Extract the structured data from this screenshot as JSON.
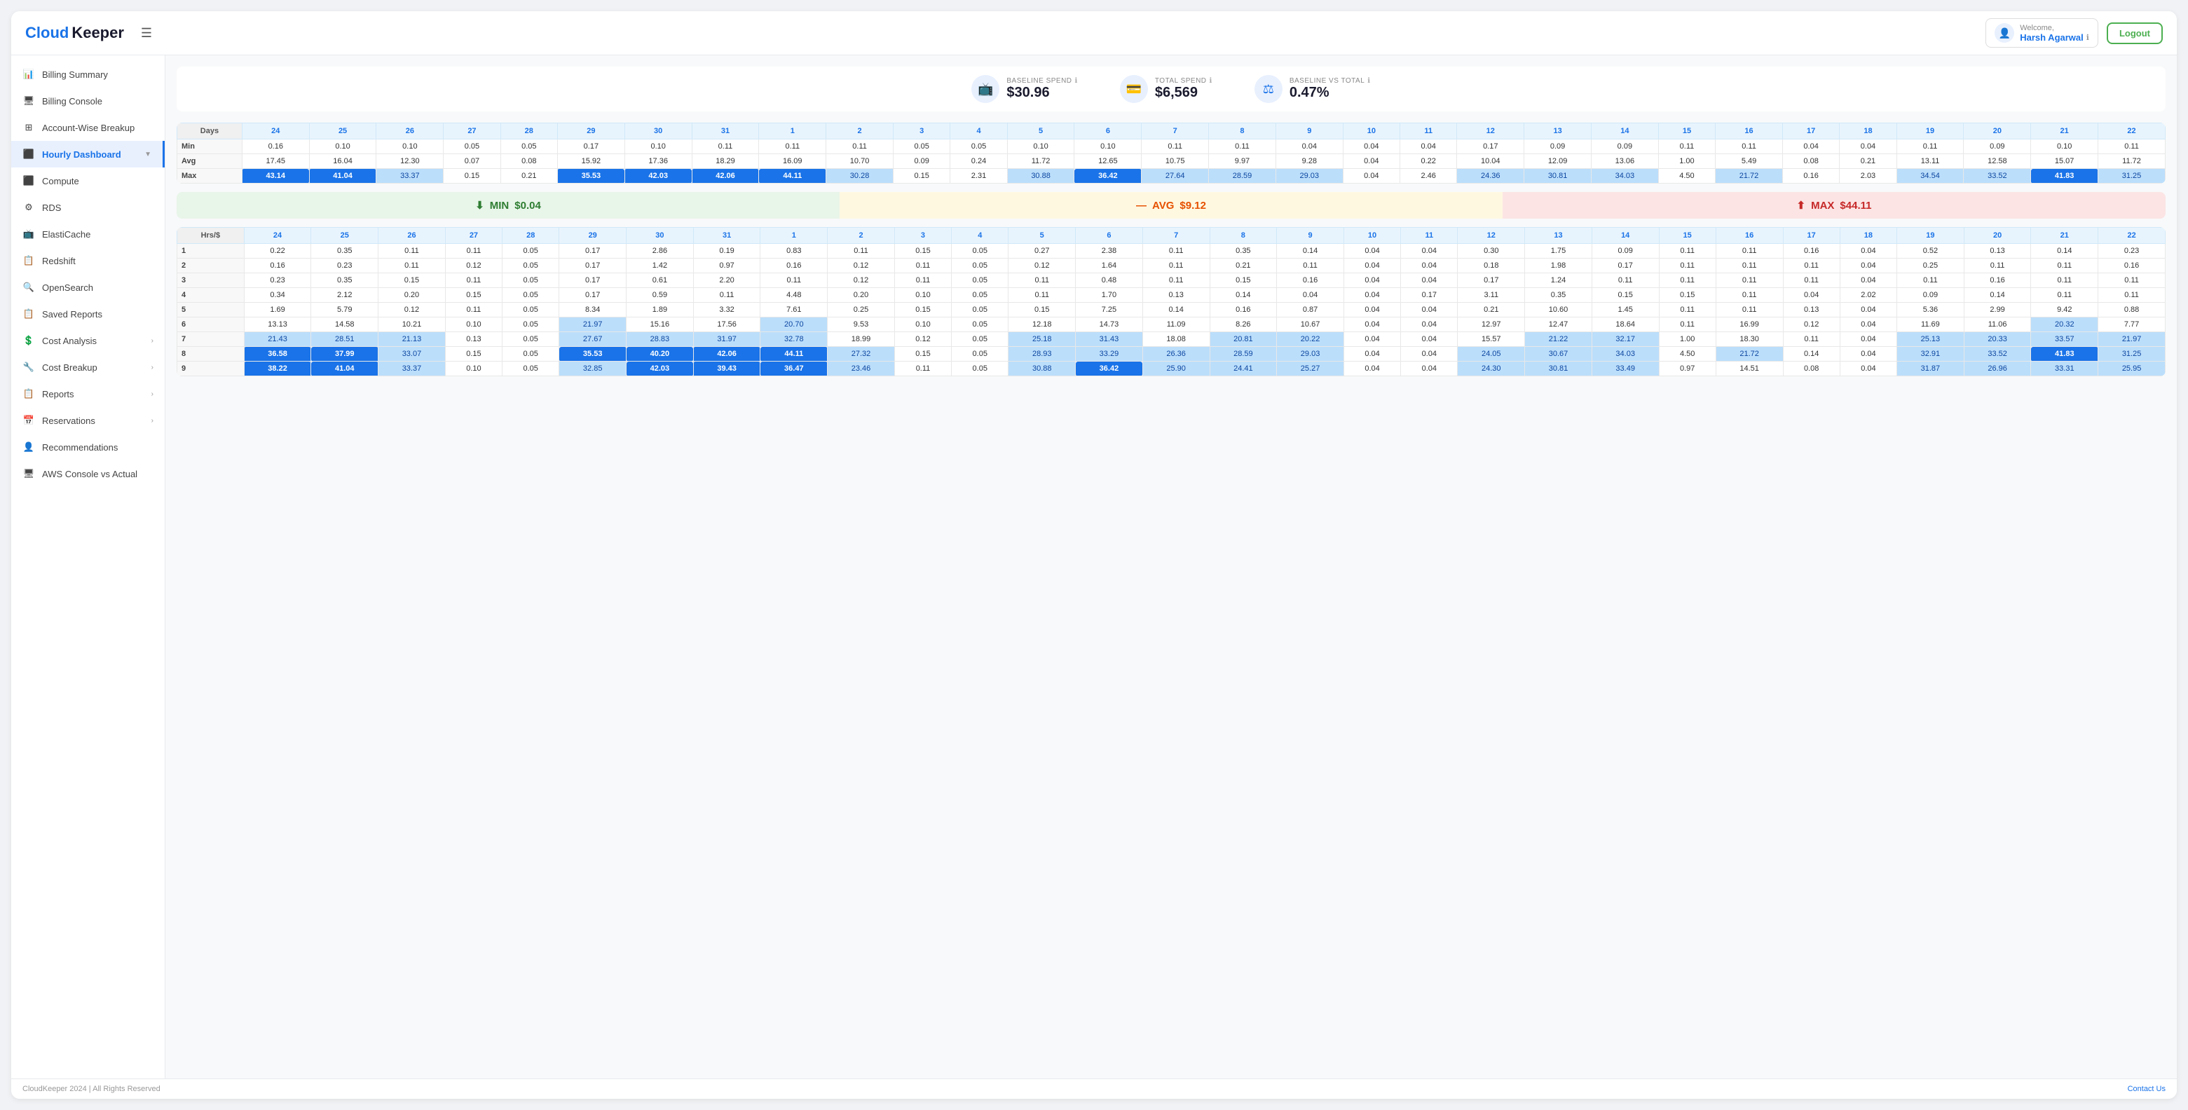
{
  "header": {
    "logo_cloud": "Cloud",
    "logo_keeper": "Keeper",
    "hamburger_label": "☰",
    "welcome_prefix": "Welcome,",
    "username": "Harsh Agarwal",
    "logout_label": "Logout"
  },
  "sidebar": {
    "items": [
      {
        "id": "billing-summary",
        "label": "Billing Summary",
        "icon": "📊",
        "active": false
      },
      {
        "id": "billing-console",
        "label": "Billing Console",
        "icon": "🖥",
        "active": false
      },
      {
        "id": "account-wise-breakup",
        "label": "Account-Wise Breakup",
        "icon": "⊞",
        "active": false
      },
      {
        "id": "hourly-dashboard",
        "label": "Hourly Dashboard",
        "icon": "⬛",
        "active": true,
        "hasArrow": true
      },
      {
        "id": "compute",
        "label": "Compute",
        "icon": "⬛",
        "active": false
      },
      {
        "id": "rds",
        "label": "RDS",
        "icon": "⚙",
        "active": false
      },
      {
        "id": "elasticache",
        "label": "ElastiCache",
        "icon": "📺",
        "active": false
      },
      {
        "id": "redshift",
        "label": "Redshift",
        "icon": "📋",
        "active": false
      },
      {
        "id": "opensearch",
        "label": "OpenSearch",
        "icon": "🔍",
        "active": false
      },
      {
        "id": "saved-reports",
        "label": "Saved Reports",
        "icon": "📋",
        "active": false
      },
      {
        "id": "cost-analysis",
        "label": "Cost Analysis",
        "icon": "💲",
        "active": false,
        "hasArrow": true
      },
      {
        "id": "cost-breakup",
        "label": "Cost Breakup",
        "icon": "🔧",
        "active": false,
        "hasArrow": true
      },
      {
        "id": "reports",
        "label": "Reports",
        "icon": "📋",
        "active": false,
        "hasArrow": true
      },
      {
        "id": "reservations",
        "label": "Reservations",
        "icon": "📅",
        "active": false,
        "hasArrow": true
      },
      {
        "id": "recommendations",
        "label": "Recommendations",
        "icon": "👤",
        "active": false
      },
      {
        "id": "aws-console-vs-actual",
        "label": "AWS Console vs Actual",
        "icon": "🖥",
        "active": false
      }
    ]
  },
  "stats": {
    "baseline_spend_label": "BASELINE SPEND",
    "baseline_spend_value": "$30.96",
    "total_spend_label": "TOTAL SPEND",
    "total_spend_value": "$6,569",
    "baseline_vs_total_label": "BASELINE vs TOTAL",
    "baseline_vs_total_value": "0.47%"
  },
  "summary": {
    "min_label": "MIN",
    "min_value": "$0.04",
    "avg_label": "AVG",
    "avg_value": "$9.12",
    "max_label": "MAX",
    "max_value": "$44.11"
  },
  "top_table": {
    "headers": [
      "Days",
      "24",
      "25",
      "26",
      "27",
      "28",
      "29",
      "30",
      "31",
      "1",
      "2",
      "3",
      "4",
      "5",
      "6",
      "7",
      "8",
      "9",
      "10",
      "11",
      "12",
      "13",
      "14",
      "15",
      "16",
      "17",
      "18",
      "19",
      "20",
      "21",
      "22"
    ],
    "rows": [
      {
        "label": "Min",
        "values": [
          "0.16",
          "0.10",
          "0.10",
          "0.05",
          "0.05",
          "0.17",
          "0.10",
          "0.11",
          "0.11",
          "0.11",
          "0.05",
          "0.05",
          "0.10",
          "0.10",
          "0.11",
          "0.11",
          "0.04",
          "0.04",
          "0.04",
          "0.17",
          "0.09",
          "0.09",
          "0.11",
          "0.11",
          "0.04",
          "0.04",
          "0.11",
          "0.09",
          "0.10",
          "0.11"
        ]
      },
      {
        "label": "Avg",
        "values": [
          "17.45",
          "16.04",
          "12.30",
          "0.07",
          "0.08",
          "15.92",
          "17.36",
          "18.29",
          "16.09",
          "10.70",
          "0.09",
          "0.24",
          "11.72",
          "12.65",
          "10.75",
          "9.97",
          "9.28",
          "0.04",
          "0.22",
          "10.04",
          "12.09",
          "13.06",
          "1.00",
          "5.49",
          "0.08",
          "0.21",
          "13.11",
          "12.58",
          "15.07",
          "11.72"
        ]
      },
      {
        "label": "Max",
        "values": [
          "43.14",
          "41.04",
          "33.37",
          "0.15",
          "0.21",
          "35.53",
          "42.03",
          "42.06",
          "44.11",
          "30.28",
          "0.15",
          "2.31",
          "30.88",
          "36.42",
          "27.64",
          "28.59",
          "29.03",
          "0.04",
          "2.46",
          "24.36",
          "30.81",
          "34.03",
          "4.50",
          "21.72",
          "0.16",
          "2.03",
          "34.54",
          "33.52",
          "41.83",
          "31.25"
        ]
      }
    ]
  },
  "main_table": {
    "headers": [
      "Hrs/$",
      "24",
      "25",
      "26",
      "27",
      "28",
      "29",
      "30",
      "31",
      "1",
      "2",
      "3",
      "4",
      "5",
      "6",
      "7",
      "8",
      "9",
      "10",
      "11",
      "12",
      "13",
      "14",
      "15",
      "16",
      "17",
      "18",
      "19",
      "20",
      "21",
      "22"
    ],
    "rows": [
      {
        "label": "1",
        "values": [
          "0.22",
          "0.35",
          "0.11",
          "0.11",
          "0.05",
          "0.17",
          "2.86",
          "0.19",
          "0.83",
          "0.11",
          "0.15",
          "0.05",
          "0.27",
          "2.38",
          "0.11",
          "0.35",
          "0.14",
          "0.04",
          "0.04",
          "0.30",
          "1.75",
          "0.09",
          "0.11",
          "0.11",
          "0.16",
          "0.04",
          "0.52",
          "0.13",
          "0.14",
          "0.23"
        ]
      },
      {
        "label": "2",
        "values": [
          "0.16",
          "0.23",
          "0.11",
          "0.12",
          "0.05",
          "0.17",
          "1.42",
          "0.97",
          "0.16",
          "0.12",
          "0.11",
          "0.05",
          "0.12",
          "1.64",
          "0.11",
          "0.21",
          "0.11",
          "0.04",
          "0.04",
          "0.18",
          "1.98",
          "0.17",
          "0.11",
          "0.11",
          "0.11",
          "0.04",
          "0.25",
          "0.11",
          "0.11",
          "0.16"
        ]
      },
      {
        "label": "3",
        "values": [
          "0.23",
          "0.35",
          "0.15",
          "0.11",
          "0.05",
          "0.17",
          "0.61",
          "2.20",
          "0.11",
          "0.12",
          "0.11",
          "0.05",
          "0.11",
          "0.48",
          "0.11",
          "0.15",
          "0.16",
          "0.04",
          "0.04",
          "0.17",
          "1.24",
          "0.11",
          "0.11",
          "0.11",
          "0.11",
          "0.04",
          "0.11",
          "0.16",
          "0.11",
          "0.11"
        ]
      },
      {
        "label": "4",
        "values": [
          "0.34",
          "2.12",
          "0.20",
          "0.15",
          "0.05",
          "0.17",
          "0.59",
          "0.11",
          "4.48",
          "0.20",
          "0.10",
          "0.05",
          "0.11",
          "1.70",
          "0.13",
          "0.14",
          "0.04",
          "0.04",
          "0.17",
          "3.11",
          "0.35",
          "0.15",
          "0.15",
          "0.11",
          "0.04",
          "2.02",
          "0.09",
          "0.14",
          "0.11",
          "0.11"
        ]
      },
      {
        "label": "5",
        "values": [
          "1.69",
          "5.79",
          "0.12",
          "0.11",
          "0.05",
          "8.34",
          "1.89",
          "3.32",
          "7.61",
          "0.25",
          "0.15",
          "0.05",
          "0.15",
          "7.25",
          "0.14",
          "0.16",
          "0.87",
          "0.04",
          "0.04",
          "0.21",
          "10.60",
          "1.45",
          "0.11",
          "0.11",
          "0.13",
          "0.04",
          "5.36",
          "2.99",
          "9.42",
          "0.88"
        ]
      },
      {
        "label": "6",
        "values": [
          "13.13",
          "14.58",
          "10.21",
          "0.10",
          "0.05",
          "21.97",
          "15.16",
          "17.56",
          "20.70",
          "9.53",
          "0.10",
          "0.05",
          "12.18",
          "14.73",
          "11.09",
          "8.26",
          "10.67",
          "0.04",
          "0.04",
          "12.97",
          "12.47",
          "18.64",
          "0.11",
          "16.99",
          "0.12",
          "0.04",
          "11.69",
          "11.06",
          "20.32",
          "7.77"
        ]
      },
      {
        "label": "7",
        "values": [
          "21.43",
          "28.51",
          "21.13",
          "0.13",
          "0.05",
          "27.67",
          "28.83",
          "31.97",
          "32.78",
          "18.99",
          "0.12",
          "0.05",
          "25.18",
          "31.43",
          "18.08",
          "20.81",
          "20.22",
          "0.04",
          "0.04",
          "15.57",
          "21.22",
          "32.17",
          "1.00",
          "18.30",
          "0.11",
          "0.04",
          "25.13",
          "20.33",
          "33.57",
          "21.97"
        ]
      },
      {
        "label": "8",
        "values": [
          "36.58",
          "37.99",
          "33.07",
          "0.15",
          "0.05",
          "35.53",
          "40.20",
          "42.06",
          "44.11",
          "27.32",
          "0.15",
          "0.05",
          "28.93",
          "33.29",
          "26.36",
          "28.59",
          "29.03",
          "0.04",
          "0.04",
          "24.05",
          "30.67",
          "34.03",
          "4.50",
          "21.72",
          "0.14",
          "0.04",
          "32.91",
          "33.52",
          "41.83",
          "31.25"
        ]
      },
      {
        "label": "9",
        "values": [
          "38.22",
          "41.04",
          "33.37",
          "0.10",
          "0.05",
          "32.85",
          "42.03",
          "39.43",
          "36.47",
          "23.46",
          "0.11",
          "0.05",
          "30.88",
          "36.42",
          "25.90",
          "24.41",
          "25.27",
          "0.04",
          "0.04",
          "24.30",
          "30.81",
          "33.49",
          "0.97",
          "14.51",
          "0.08",
          "0.04",
          "31.87",
          "26.96",
          "33.31",
          "25.95"
        ]
      }
    ]
  },
  "footer": {
    "copyright": "CloudKeeper 2024 | All Rights Reserved",
    "contact": "Contact Us"
  }
}
